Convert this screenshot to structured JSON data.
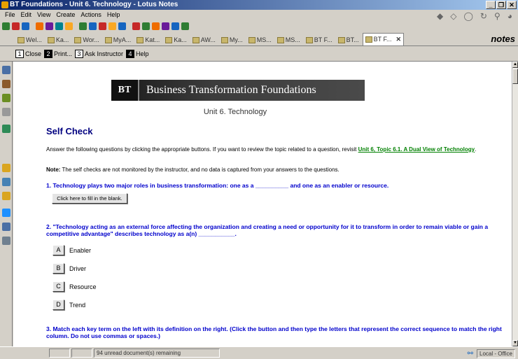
{
  "window": {
    "title": "BT Foundations - Unit 6. Technology - Lotus Notes",
    "buttons": {
      "minimize": "_",
      "restore": "❐",
      "close": "✕"
    }
  },
  "menu": [
    "File",
    "Edit",
    "View",
    "Create",
    "Actions",
    "Help"
  ],
  "toolbar_icon_colors": [
    "#2e7d32",
    "#c62828",
    "#1565c0",
    "#ef6c00",
    "#6a1b9a",
    "#00838f",
    "#f9a825",
    "#2e7d32",
    "#1565c0",
    "#c62828",
    "#f9a825",
    "#1565c0",
    "#c62828",
    "#2e7d32",
    "#ef6c00",
    "#6a1b9a",
    "#1565c0",
    "#2e7d32"
  ],
  "tabs": [
    {
      "label": "Wel..."
    },
    {
      "label": "Ka..."
    },
    {
      "label": "Wor..."
    },
    {
      "label": "MyA..."
    },
    {
      "label": "Kat..."
    },
    {
      "label": "Ka..."
    },
    {
      "label": "AW..."
    },
    {
      "label": "My..."
    },
    {
      "label": "MS..."
    },
    {
      "label": "MS..."
    },
    {
      "label": "BT F..."
    },
    {
      "label": "BT..."
    },
    {
      "label": "BT F..."
    }
  ],
  "tab_close": "✕",
  "brand": "notes",
  "actions": [
    {
      "num": "1",
      "label": "Close"
    },
    {
      "num": "2",
      "label": "Print..."
    },
    {
      "num": "3",
      "label": "Ask Instructor"
    },
    {
      "num": "4",
      "label": "Help"
    }
  ],
  "sidebar_icon_colors": [
    "#4a6fa5",
    "#8b5a2b",
    "#6b8e23",
    "#999999",
    "#2e8b57",
    "#daa520",
    "#4682b4",
    "#daa520",
    "#1e90ff",
    "#4a6fa5",
    "#708090"
  ],
  "page": {
    "banner_logo": "BT",
    "banner_title": "Business Transformation Foundations",
    "unit_title": "Unit 6. Technology",
    "heading": "Self Check",
    "intro_text": "Answer the following questions by clicking the appropriate buttons.  If you want to review the topic related to a question, revisit ",
    "intro_link": "Unit 6, Topic 6.1. A Dual View of Technology",
    "intro_end": ".",
    "note_label": "Note:",
    "note_text": " The self checks are not monitored by the instructor, and no data is captured from your answers to the questions.",
    "q1": "1. Technology plays two major roles in business transformation: one as a __________ and one as an enabler or resource.",
    "fill_button": "Click here to fill in the blank.",
    "q2": "2. \"Technology acting as an external force affecting the organization and creating a need or opportunity for it to transform in order to remain viable or gain a competitive advantage\" describes technology as a(n) ___________.",
    "options": [
      {
        "letter": "A",
        "text": "Enabler"
      },
      {
        "letter": "B",
        "text": "Driver"
      },
      {
        "letter": "C",
        "text": "Resource"
      },
      {
        "letter": "D",
        "text": "Trend"
      }
    ],
    "q3": "3. Match each key term on the left with its definition on the right.  (Click the button and then type the letters that represent the correct sequence to match the right column.  Do not use commas or spaces.)"
  },
  "status": {
    "cell1": "",
    "cell2": "",
    "unread": "94 unread document(s) remaining",
    "location": "Local - Office"
  }
}
